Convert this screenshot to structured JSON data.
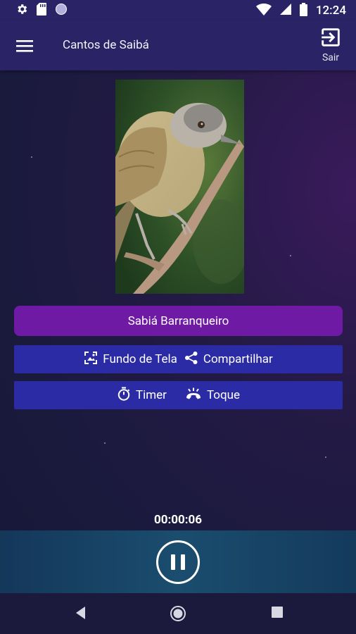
{
  "status_bar": {
    "time": "12:24",
    "icons": [
      "settings-icon",
      "sd-card-icon",
      "circle-icon",
      "wifi-icon",
      "signal-icon",
      "battery-icon"
    ]
  },
  "app_bar": {
    "title": "Cantos de Saibá",
    "exit_label": "Sair",
    "icons": [
      "hamburger-menu-icon",
      "exit-icon"
    ]
  },
  "main": {
    "song_button_label": "Sabiá Barranqueiro",
    "wallpaper_label": "Fundo de Tela",
    "share_label": "Compartilhar",
    "timer_label": "Timer",
    "ringtone_label": "Toque",
    "icons": [
      "wallpaper-icon",
      "share-icon",
      "stopwatch-icon",
      "ringtone-icon"
    ]
  },
  "player": {
    "elapsed": "00:00:06",
    "state_icon": "pause-icon"
  },
  "nav_bar": {
    "icons": [
      "back-icon",
      "home-icon",
      "recents-icon"
    ]
  },
  "colors": {
    "app_bar": "#2a2466",
    "song_button": "#6e1aa4",
    "action_buttons": "#2b2ba6",
    "player_bar": "#1a4d6e",
    "nav_bar": "#1b1a3c"
  }
}
